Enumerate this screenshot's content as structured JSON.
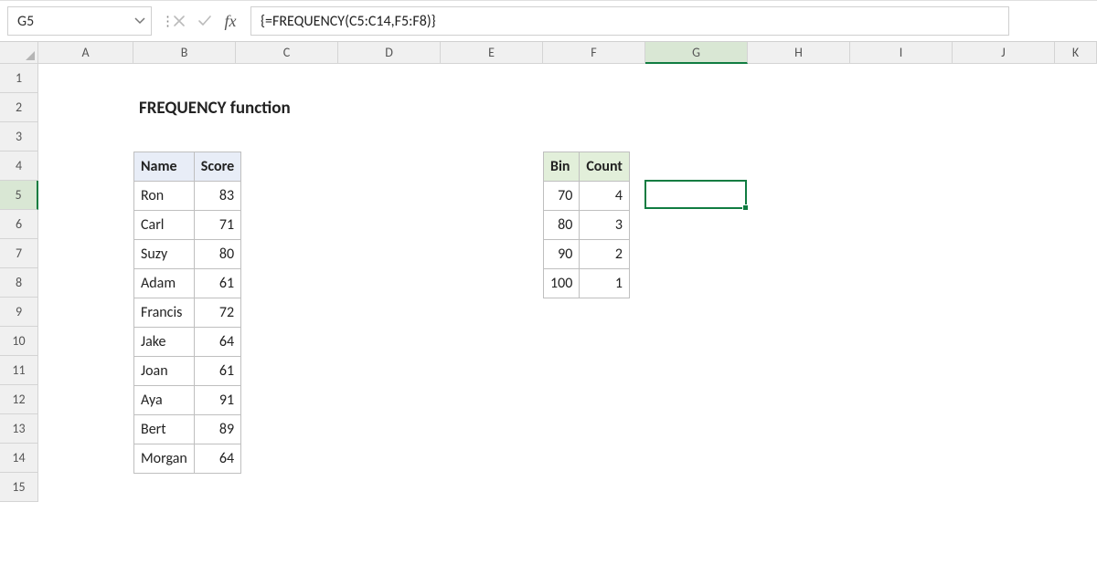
{
  "namebox": {
    "value": "G5"
  },
  "formula_bar": {
    "text": "{=FREQUENCY(C5:C14,F5:F8)}",
    "fx_label": "fx"
  },
  "title": "FREQUENCY function",
  "columns": {
    "labels": [
      "A",
      "B",
      "C",
      "D",
      "E",
      "F",
      "G",
      "H",
      "I",
      "J",
      "K"
    ],
    "widths": [
      104,
      112,
      112,
      112,
      112,
      112,
      112,
      112,
      112,
      112,
      46
    ],
    "active_index": 6
  },
  "rows": {
    "labels": [
      "1",
      "2",
      "3",
      "4",
      "5",
      "6",
      "7",
      "8",
      "9",
      "10",
      "11",
      "12",
      "13",
      "14",
      "15"
    ],
    "heights": [
      32,
      32,
      32,
      32,
      32,
      32,
      32,
      32,
      32,
      32,
      32,
      32,
      32,
      32,
      32
    ],
    "active_index": 4
  },
  "data_table": {
    "headers": [
      "Name",
      "Score"
    ],
    "rows": [
      [
        "Ron",
        83
      ],
      [
        "Carl",
        71
      ],
      [
        "Suzy",
        80
      ],
      [
        "Adam",
        61
      ],
      [
        "Francis",
        72
      ],
      [
        "Jake",
        64
      ],
      [
        "Joan",
        61
      ],
      [
        "Aya",
        91
      ],
      [
        "Bert",
        89
      ],
      [
        "Morgan",
        64
      ]
    ]
  },
  "result_table": {
    "headers": [
      "Bin",
      "Count"
    ],
    "rows": [
      [
        70,
        4
      ],
      [
        80,
        3
      ],
      [
        90,
        2
      ],
      [
        100,
        1
      ]
    ]
  },
  "selected_cell": {
    "col": 6,
    "row": 4
  }
}
